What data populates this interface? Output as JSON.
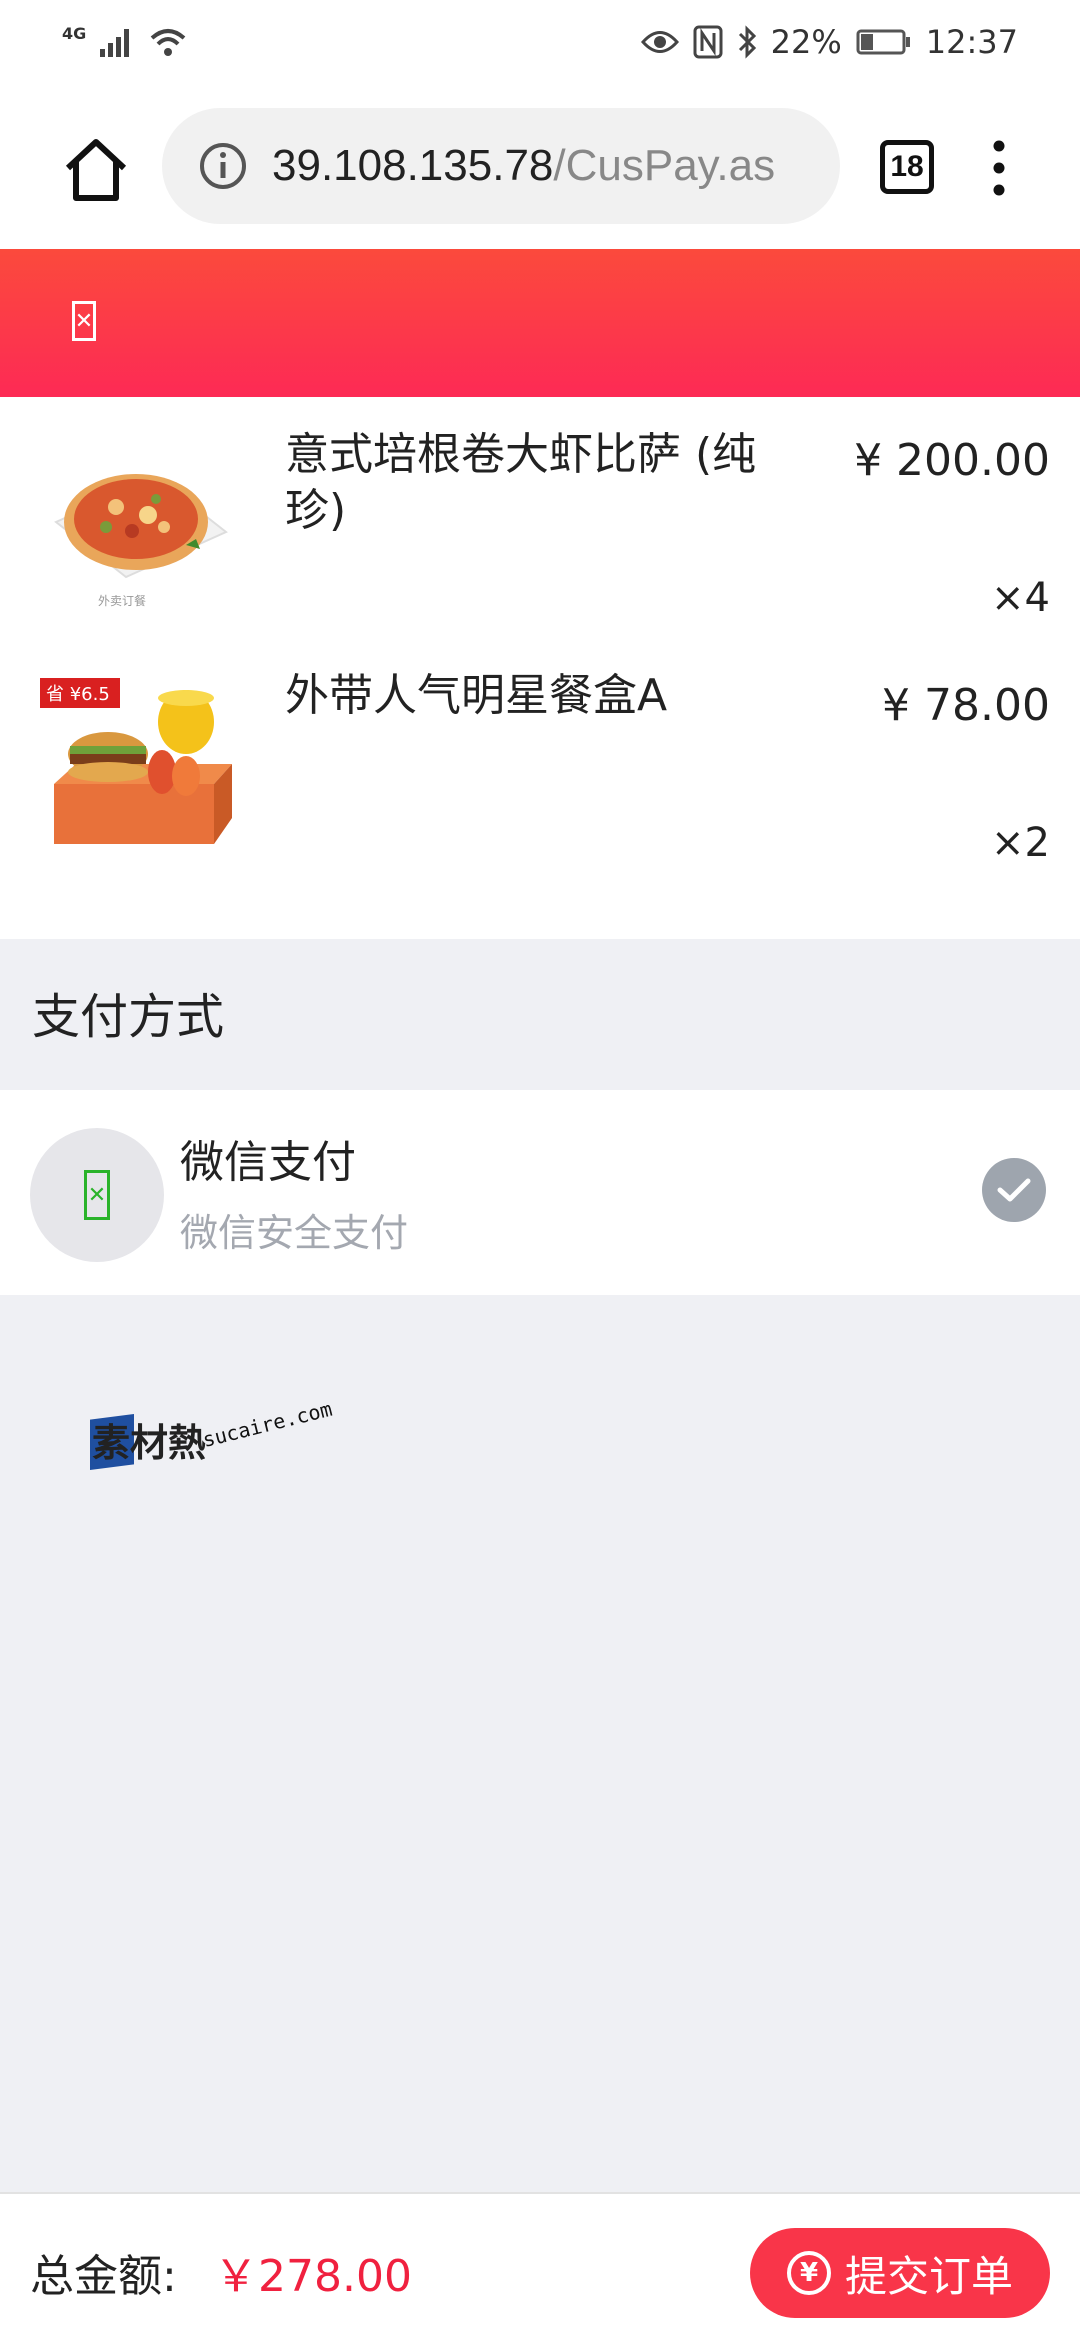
{
  "status_bar": {
    "network": "4G",
    "battery": "22%",
    "time": "12:37"
  },
  "browser": {
    "url_host": "39.108.135.78",
    "url_path": "/CusPay.as",
    "tab_count": "18"
  },
  "header": {
    "back_icon": "back-icon"
  },
  "orders": [
    {
      "name": "意式培根卷大虾比萨 (纯珍)",
      "price": "¥ 200.00",
      "qty": "×4",
      "thumb_caption": "外卖订餐"
    },
    {
      "name": "外带人气明星餐盒A",
      "price": "¥ 78.00",
      "qty": "×2",
      "badge": "省 ¥6.5"
    }
  ],
  "payment": {
    "section_title": "支付方式",
    "method_name": "微信支付",
    "method_desc": "微信安全支付",
    "selected": true
  },
  "watermark": {
    "text": "素材熱",
    "domain": "sucaire.com"
  },
  "footer": {
    "total_label": "总金额:",
    "total_value": "￥278.00",
    "submit_label": "提交订单"
  },
  "colors": {
    "header_gradient_top": "#fb4a3c",
    "header_gradient_bottom": "#fd2a55",
    "price_red": "#f0213f",
    "submit_button": "#f93549",
    "wechat_green": "#2ab32a"
  }
}
